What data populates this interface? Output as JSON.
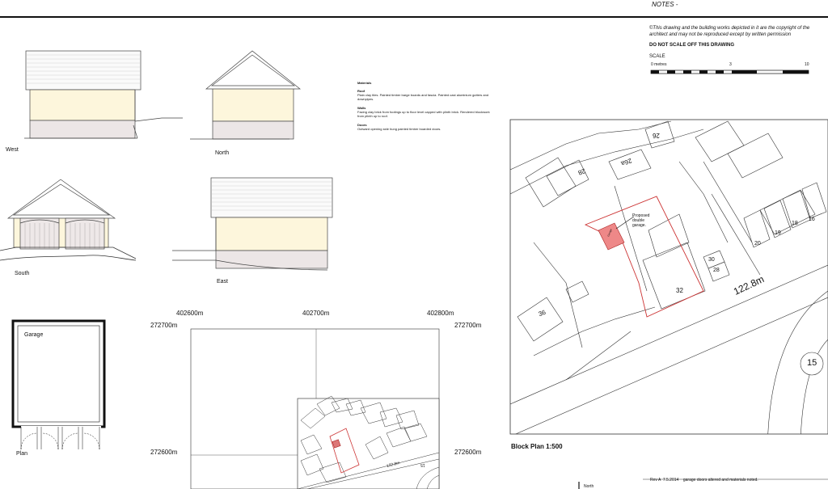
{
  "notes_title": "NOTES -",
  "copyright": "This drawing and the building works depicted in it are the copyright of the architect and may not be reproduced except by written permission",
  "do_not_scale": "DO NOT SCALE OFF THIS DRAWING",
  "scale": {
    "title": "SCALE",
    "t0": "0 metres",
    "t1": "3",
    "t2": "10"
  },
  "elevations": {
    "west": "West",
    "north": "North",
    "south": "South",
    "east": "East"
  },
  "plan": {
    "title": "Plan",
    "room": "Garage"
  },
  "materials": {
    "heading": "Materials",
    "roof_h": "Roof",
    "roof_t": "Plain clay tiles. Painted timber barge boards and fascia. Painted cast aluminium gutters and downpipes.",
    "walls_h": "Walls",
    "walls_t": "Facing clay brick from footings up to floor level capped with plinth brick. Rendered blockwork from plinth up to roof.",
    "doors_h": "Doors",
    "doors_t": "Outward opening side hung painted timber boarded doors."
  },
  "location": {
    "x1": "402600m",
    "x2": "402700m",
    "x3": "402800m",
    "y1": "272700m",
    "y2": "272600m",
    "road": "122.8m",
    "house": "15"
  },
  "block_plan": {
    "title": "Block Plan 1:500",
    "proposed": "Proposed double garage.",
    "garage": "Garage",
    "road": "122.8m",
    "n26": "26",
    "n26a": "26a",
    "n28b": "28",
    "n36": "36",
    "n30": "30",
    "n28": "28",
    "n32": "32",
    "n20": "20",
    "n19": "19",
    "n18": "18",
    "n16": "16",
    "n15": "15"
  },
  "revision": "Rev A  7.5.2014    garage doors altered and materials noted.",
  "north": "North"
}
